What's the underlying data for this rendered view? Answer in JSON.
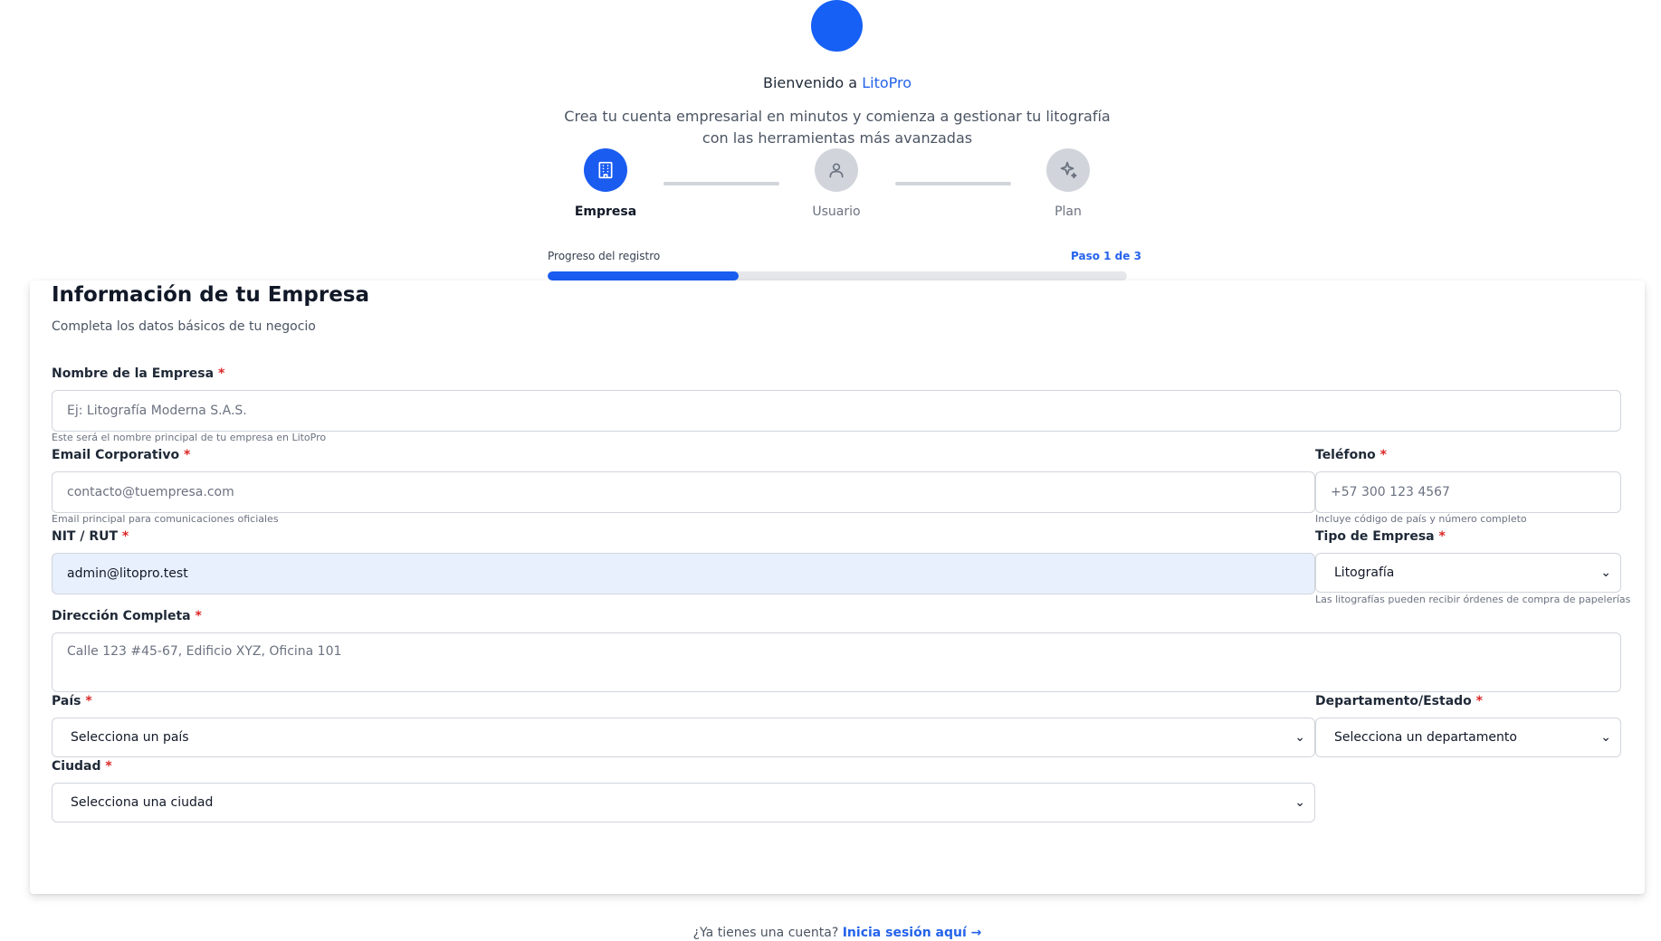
{
  "header": {
    "welcome_prefix": "Bienvenido a ",
    "brand": "LitoPro",
    "subtitle": "Crea tu cuenta empresarial en minutos y comienza a gestionar tu litografía con las herramientas más avanzadas"
  },
  "steps": [
    {
      "label": "Empresa",
      "icon": "building-icon",
      "active": true
    },
    {
      "label": "Usuario",
      "icon": "user-icon",
      "active": false
    },
    {
      "label": "Plan",
      "icon": "sparkles-icon",
      "active": false
    }
  ],
  "progress": {
    "label": "Progreso del registro",
    "step_text": "Paso 1 de 3",
    "fraction": 0.33
  },
  "form": {
    "title": "Información de tu Empresa",
    "description": "Completa los datos básicos de tu negocio",
    "company_name": {
      "label": "Nombre de la Empresa",
      "placeholder": "Ej: Litografía Moderna S.A.S.",
      "hint": "Este será el nombre principal de tu empresa en LitoPro"
    },
    "email": {
      "label": "Email Corporativo",
      "placeholder": "contacto@tuempresa.com",
      "hint": "Email principal para comunicaciones oficiales"
    },
    "phone": {
      "label": "Teléfono",
      "placeholder": "+57 300 123 4567",
      "hint": "Incluye código de país y número completo"
    },
    "nit": {
      "label": "NIT / RUT",
      "value": "admin@litopro.test"
    },
    "company_type": {
      "label": "Tipo de Empresa",
      "value": "Litografía",
      "hint": "Las litografías pueden recibir órdenes de compra de papelerías"
    },
    "address": {
      "label": "Dirección Completa",
      "placeholder": "Calle 123 #45-67, Edificio XYZ, Oficina 101"
    },
    "country": {
      "label": "País",
      "value": "Selecciona un país"
    },
    "state": {
      "label": "Departamento/Estado",
      "value": "Selecciona un departamento"
    },
    "city": {
      "label": "Ciudad",
      "value": "Selecciona una ciudad"
    },
    "required_mark": "*"
  },
  "footer": {
    "question": "¿Ya tienes una cuenta? ",
    "link": "Inicia sesión aquí →"
  },
  "colors": {
    "primary": "#1a5cf0",
    "required": "#dc2626",
    "autofill": "#e8f0fe"
  }
}
